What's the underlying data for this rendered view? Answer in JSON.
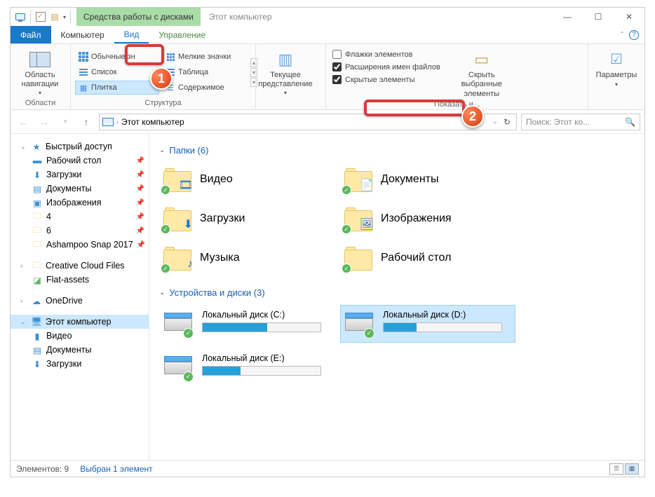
{
  "titlebar": {
    "tool_tab": "Средства работы с дисками",
    "title": "Этот компьютер"
  },
  "win_controls": {
    "min": "—",
    "max": "☐",
    "close": "✕"
  },
  "tabs": {
    "file": "Файл",
    "computer": "Компьютер",
    "view": "Вид",
    "manage": "Управление"
  },
  "ribbon": {
    "nav_pane": "Область навигации",
    "areas_label": "Области",
    "layouts": {
      "normal": "Обычные зн",
      "small": "Мелкие значки",
      "list": "Список",
      "table": "Таблица",
      "tiles": "Плитка",
      "content": "Содержимое"
    },
    "structure_label": "Структура",
    "current_view": "Текущее представление",
    "checks": {
      "checkboxes": "Флажки элементов",
      "extensions": "Расширения имен файлов",
      "hidden": "Скрытые элементы"
    },
    "hide_selected_l1": "Скрыть выбранные",
    "hide_selected_l2": "элементы",
    "show_hide_label": "Показать и...",
    "options": "Параметры"
  },
  "address": {
    "path": "Этот компьютер",
    "search_placeholder": "Поиск: Этот ко...",
    "refresh": "↻"
  },
  "sidebar": {
    "quick_access": "Быстрый доступ",
    "desktop": "Рабочий стол",
    "downloads": "Загрузки",
    "documents": "Документы",
    "pictures": "Изображения",
    "four": "4",
    "six": "6",
    "ashampoo": "Ashampoo Snap 2017",
    "ccf": "Creative Cloud Files",
    "flat": "Flat-assets",
    "onedrive": "OneDrive",
    "this_pc": "Этот компьютер",
    "video": "Видео",
    "documents2": "Документы",
    "downloads2": "Загрузки"
  },
  "content": {
    "folders_header": "Папки (6)",
    "folders": [
      {
        "name": "Видео",
        "overlay": "film"
      },
      {
        "name": "Документы",
        "overlay": "doc"
      },
      {
        "name": "Загрузки",
        "overlay": "down"
      },
      {
        "name": "Изображения",
        "overlay": "pic"
      },
      {
        "name": "Музыка",
        "overlay": "music"
      },
      {
        "name": "Рабочий стол",
        "overlay": ""
      }
    ],
    "drives_header": "Устройства и диски (3)",
    "drives": [
      {
        "name": "Локальный диск (C:)",
        "fill": 55,
        "selected": false
      },
      {
        "name": "Локальный диск (D:)",
        "fill": 28,
        "selected": true
      },
      {
        "name": "Локальный диск (E:)",
        "fill": 32,
        "selected": false
      }
    ]
  },
  "status": {
    "count": "Элементов: 9",
    "selection": "Выбран 1 элемент"
  },
  "annotations": {
    "one": "1",
    "two": "2"
  }
}
